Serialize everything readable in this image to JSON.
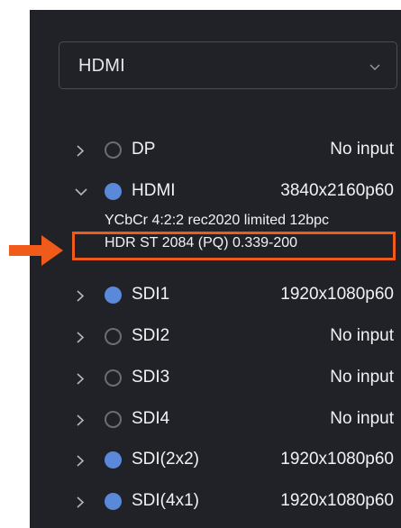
{
  "source_select": {
    "selected": "HDMI",
    "icon": "chevron-down-icon"
  },
  "inputs": [
    {
      "name": "DP",
      "value": "No input",
      "active": false,
      "expanded": false
    },
    {
      "name": "HDMI",
      "value": "3840x2160p60",
      "active": true,
      "expanded": true
    },
    {
      "name": "SDI1",
      "value": "1920x1080p60",
      "active": true,
      "expanded": false
    },
    {
      "name": "SDI2",
      "value": "No input",
      "active": false,
      "expanded": false
    },
    {
      "name": "SDI3",
      "value": "No input",
      "active": false,
      "expanded": false
    },
    {
      "name": "SDI4",
      "value": "No input",
      "active": false,
      "expanded": false
    },
    {
      "name": "SDI(2x2)",
      "value": "1920x1080p60",
      "active": true,
      "expanded": false
    },
    {
      "name": "SDI(4x1)",
      "value": "1920x1080p60",
      "active": true,
      "expanded": false
    }
  ],
  "hdmi_details": {
    "color_format": "YCbCr 4:2:2 rec2020 limited 12bpc",
    "hdr_format": "HDR ST 2084 (PQ) 0.339-200"
  },
  "colors": {
    "panel_bg": "#212227",
    "active_dot": "#5b89d9",
    "annotation": "#f05a1a"
  }
}
